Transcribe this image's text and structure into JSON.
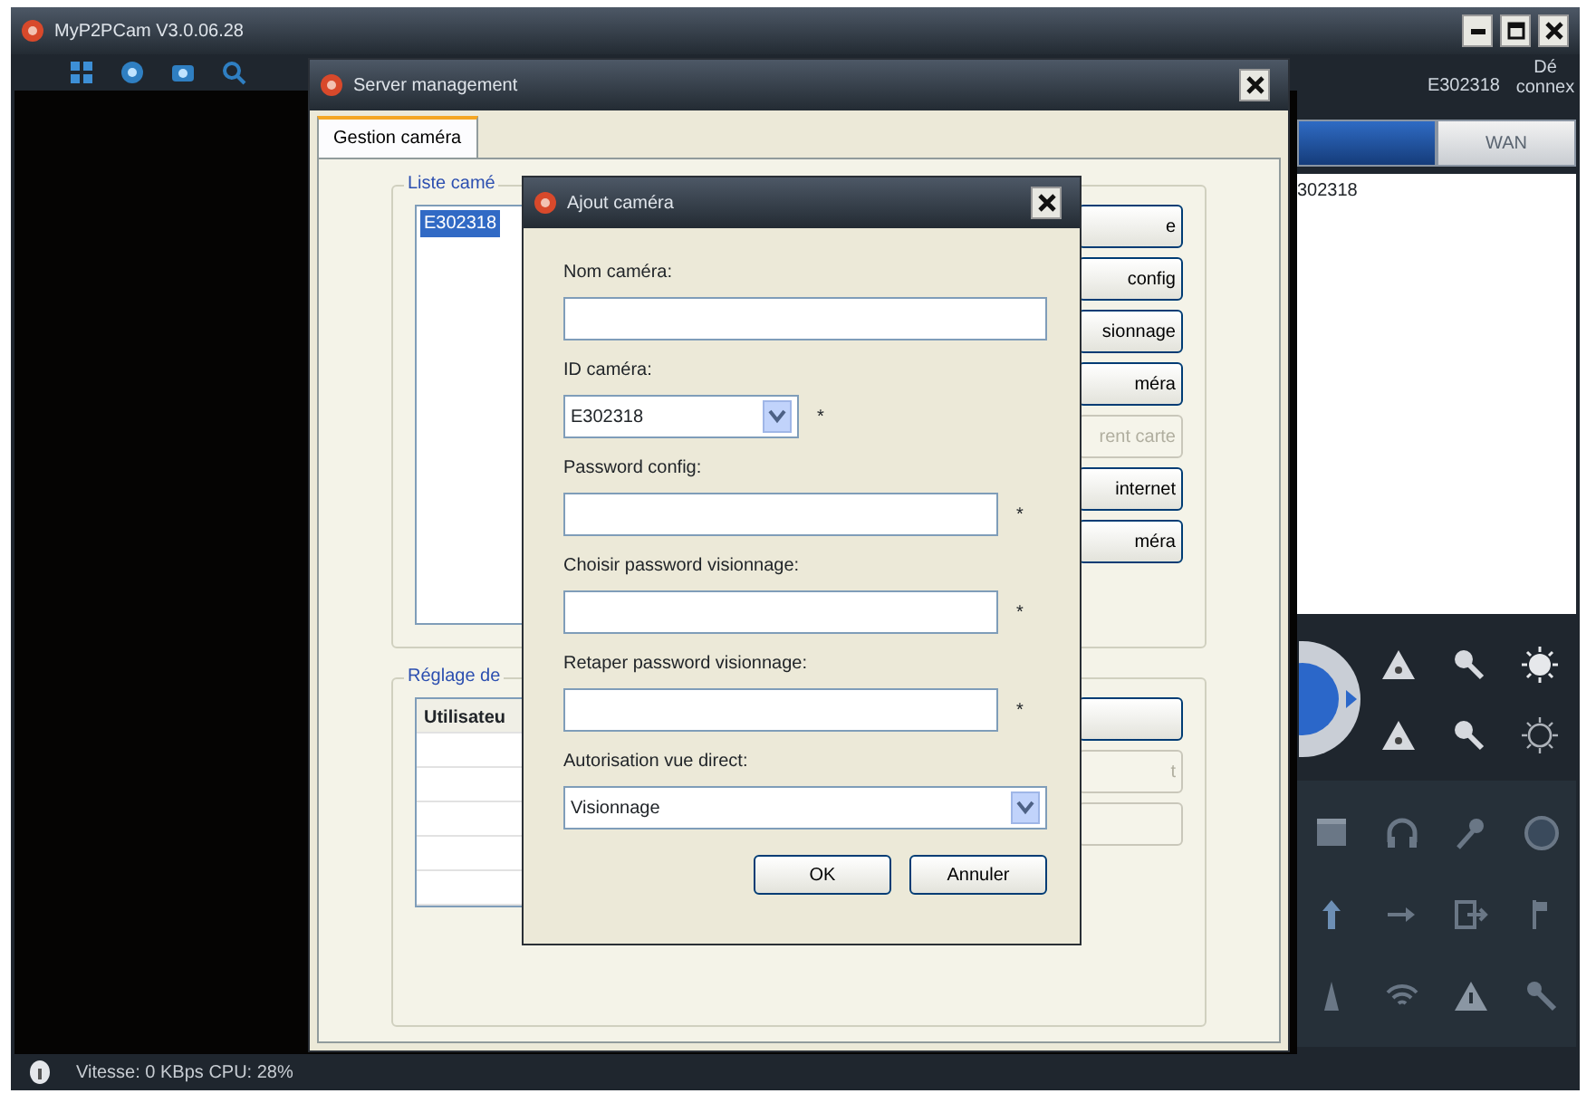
{
  "main_window": {
    "title": "MyP2PCam V3.0.06.28",
    "camera_id": "E302318",
    "disconnect": "Dé connex",
    "tabs": [
      {
        "selected": true
      },
      {
        "label": "WAN",
        "selected": false
      }
    ],
    "camera_list": [
      {
        "label": "302318"
      }
    ],
    "status": "Vitesse: 0 KBps CPU: 28%"
  },
  "server_window": {
    "title": "Server management",
    "tabs": [
      {
        "label": "Gestion caméra",
        "selected": true
      }
    ],
    "camera_group": {
      "legend": "Liste camé",
      "items": [
        {
          "label": "E302318",
          "selected": true
        }
      ],
      "buttons": [
        {
          "label": "e",
          "disabled": false
        },
        {
          "label": "config",
          "disabled": false
        },
        {
          "label": "sionnage",
          "disabled": false
        },
        {
          "label": "méra",
          "disabled": false
        },
        {
          "label": "rent carte",
          "disabled": true
        },
        {
          "label": "internet",
          "disabled": false
        },
        {
          "label": "méra",
          "disabled": false
        }
      ]
    },
    "settings_group": {
      "legend": "Réglage de",
      "columns": [
        "Utilisateu"
      ],
      "buttons": [
        {
          "disabled": false
        },
        {
          "label": "t",
          "disabled": true
        },
        {
          "disabled": true
        }
      ]
    }
  },
  "dialog": {
    "title": "Ajout caméra",
    "fields": [
      {
        "kind": "text",
        "label": "Nom caméra:"
      },
      {
        "kind": "select",
        "label": "ID caméra:",
        "value": "E302318",
        "mark": "*"
      },
      {
        "kind": "password",
        "label": "Password config:",
        "mark": "*"
      },
      {
        "kind": "password",
        "label": "Choisir password visionnage:",
        "mark": "*"
      },
      {
        "kind": "password",
        "label": "Retaper password visionnage:",
        "mark": "*"
      },
      {
        "kind": "select",
        "label": "Autorisation vue direct:",
        "value": "Visionnage"
      }
    ],
    "buttons": [
      "OK",
      "Annuler"
    ]
  }
}
